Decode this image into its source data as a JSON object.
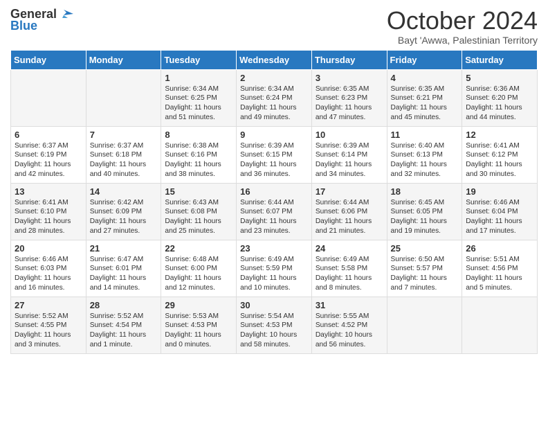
{
  "header": {
    "logo_general": "General",
    "logo_blue": "Blue",
    "month_title": "October 2024",
    "subtitle": "Bayt 'Awwa, Palestinian Territory"
  },
  "days_of_week": [
    "Sunday",
    "Monday",
    "Tuesday",
    "Wednesday",
    "Thursday",
    "Friday",
    "Saturday"
  ],
  "weeks": [
    [
      {
        "day": "",
        "info": ""
      },
      {
        "day": "",
        "info": ""
      },
      {
        "day": "1",
        "info": "Sunrise: 6:34 AM\nSunset: 6:25 PM\nDaylight: 11 hours and 51 minutes."
      },
      {
        "day": "2",
        "info": "Sunrise: 6:34 AM\nSunset: 6:24 PM\nDaylight: 11 hours and 49 minutes."
      },
      {
        "day": "3",
        "info": "Sunrise: 6:35 AM\nSunset: 6:23 PM\nDaylight: 11 hours and 47 minutes."
      },
      {
        "day": "4",
        "info": "Sunrise: 6:35 AM\nSunset: 6:21 PM\nDaylight: 11 hours and 45 minutes."
      },
      {
        "day": "5",
        "info": "Sunrise: 6:36 AM\nSunset: 6:20 PM\nDaylight: 11 hours and 44 minutes."
      }
    ],
    [
      {
        "day": "6",
        "info": "Sunrise: 6:37 AM\nSunset: 6:19 PM\nDaylight: 11 hours and 42 minutes."
      },
      {
        "day": "7",
        "info": "Sunrise: 6:37 AM\nSunset: 6:18 PM\nDaylight: 11 hours and 40 minutes."
      },
      {
        "day": "8",
        "info": "Sunrise: 6:38 AM\nSunset: 6:16 PM\nDaylight: 11 hours and 38 minutes."
      },
      {
        "day": "9",
        "info": "Sunrise: 6:39 AM\nSunset: 6:15 PM\nDaylight: 11 hours and 36 minutes."
      },
      {
        "day": "10",
        "info": "Sunrise: 6:39 AM\nSunset: 6:14 PM\nDaylight: 11 hours and 34 minutes."
      },
      {
        "day": "11",
        "info": "Sunrise: 6:40 AM\nSunset: 6:13 PM\nDaylight: 11 hours and 32 minutes."
      },
      {
        "day": "12",
        "info": "Sunrise: 6:41 AM\nSunset: 6:12 PM\nDaylight: 11 hours and 30 minutes."
      }
    ],
    [
      {
        "day": "13",
        "info": "Sunrise: 6:41 AM\nSunset: 6:10 PM\nDaylight: 11 hours and 28 minutes."
      },
      {
        "day": "14",
        "info": "Sunrise: 6:42 AM\nSunset: 6:09 PM\nDaylight: 11 hours and 27 minutes."
      },
      {
        "day": "15",
        "info": "Sunrise: 6:43 AM\nSunset: 6:08 PM\nDaylight: 11 hours and 25 minutes."
      },
      {
        "day": "16",
        "info": "Sunrise: 6:44 AM\nSunset: 6:07 PM\nDaylight: 11 hours and 23 minutes."
      },
      {
        "day": "17",
        "info": "Sunrise: 6:44 AM\nSunset: 6:06 PM\nDaylight: 11 hours and 21 minutes."
      },
      {
        "day": "18",
        "info": "Sunrise: 6:45 AM\nSunset: 6:05 PM\nDaylight: 11 hours and 19 minutes."
      },
      {
        "day": "19",
        "info": "Sunrise: 6:46 AM\nSunset: 6:04 PM\nDaylight: 11 hours and 17 minutes."
      }
    ],
    [
      {
        "day": "20",
        "info": "Sunrise: 6:46 AM\nSunset: 6:03 PM\nDaylight: 11 hours and 16 minutes."
      },
      {
        "day": "21",
        "info": "Sunrise: 6:47 AM\nSunset: 6:01 PM\nDaylight: 11 hours and 14 minutes."
      },
      {
        "day": "22",
        "info": "Sunrise: 6:48 AM\nSunset: 6:00 PM\nDaylight: 11 hours and 12 minutes."
      },
      {
        "day": "23",
        "info": "Sunrise: 6:49 AM\nSunset: 5:59 PM\nDaylight: 11 hours and 10 minutes."
      },
      {
        "day": "24",
        "info": "Sunrise: 6:49 AM\nSunset: 5:58 PM\nDaylight: 11 hours and 8 minutes."
      },
      {
        "day": "25",
        "info": "Sunrise: 6:50 AM\nSunset: 5:57 PM\nDaylight: 11 hours and 7 minutes."
      },
      {
        "day": "26",
        "info": "Sunrise: 5:51 AM\nSunset: 4:56 PM\nDaylight: 11 hours and 5 minutes."
      }
    ],
    [
      {
        "day": "27",
        "info": "Sunrise: 5:52 AM\nSunset: 4:55 PM\nDaylight: 11 hours and 3 minutes."
      },
      {
        "day": "28",
        "info": "Sunrise: 5:52 AM\nSunset: 4:54 PM\nDaylight: 11 hours and 1 minute."
      },
      {
        "day": "29",
        "info": "Sunrise: 5:53 AM\nSunset: 4:53 PM\nDaylight: 11 hours and 0 minutes."
      },
      {
        "day": "30",
        "info": "Sunrise: 5:54 AM\nSunset: 4:53 PM\nDaylight: 10 hours and 58 minutes."
      },
      {
        "day": "31",
        "info": "Sunrise: 5:55 AM\nSunset: 4:52 PM\nDaylight: 10 hours and 56 minutes."
      },
      {
        "day": "",
        "info": ""
      },
      {
        "day": "",
        "info": ""
      }
    ]
  ]
}
